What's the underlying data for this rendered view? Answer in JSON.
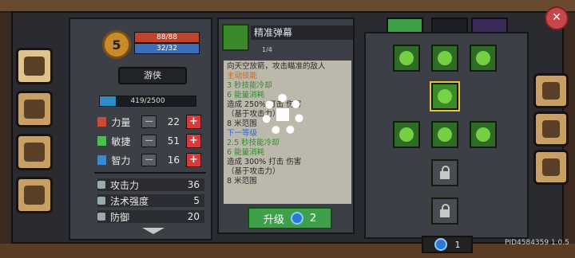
{
  "character": {
    "level": "5",
    "hp": "88/88",
    "mp": "32/32",
    "class_name": "游侠",
    "xp_text": "419/2500",
    "xp_fraction": 0.1676
  },
  "stats": [
    {
      "name": "力量",
      "value": "22",
      "icon": "fist-icon",
      "color": "#c94a3a"
    },
    {
      "name": "敏捷",
      "value": "51",
      "icon": "feather-icon",
      "color": "#4ac24a"
    },
    {
      "name": "智力",
      "value": "16",
      "icon": "book-icon",
      "color": "#3a8ad1"
    }
  ],
  "substats": [
    {
      "name": "攻击力",
      "value": "36"
    },
    {
      "name": "法术强度",
      "value": "5"
    },
    {
      "name": "防御",
      "value": "20"
    }
  ],
  "skill": {
    "name": "精准弹幕",
    "rank": "1/4",
    "lines": [
      {
        "text": "向天空放箭，攻击瞄准的敌人",
        "color": "default"
      },
      {
        "text": "主动技能",
        "color": "gold"
      },
      {
        "text": "3 秒技能冷却",
        "color": "green"
      },
      {
        "text": "6 能量消耗",
        "color": "green"
      },
      {
        "text": "造成 250% 打击 伤害",
        "color": "default"
      },
      {
        "text": "（基于攻击力）",
        "color": "default"
      },
      {
        "text": "8 米范围",
        "color": "default"
      },
      {
        "text": "下一等级",
        "color": "blue"
      },
      {
        "text": "2.5 秒技能冷却",
        "color": "green"
      },
      {
        "text": "6 能量消耗",
        "color": "green"
      },
      {
        "text": "造成 300% 打击 伤害",
        "color": "default"
      },
      {
        "text": "（基于攻击力）",
        "color": "default"
      },
      {
        "text": "8 米范围",
        "color": "default"
      }
    ],
    "upgrade_label": "升级",
    "upgrade_cost": "2"
  },
  "skill_points": "1",
  "pid": "PID4584359 1.0.5"
}
